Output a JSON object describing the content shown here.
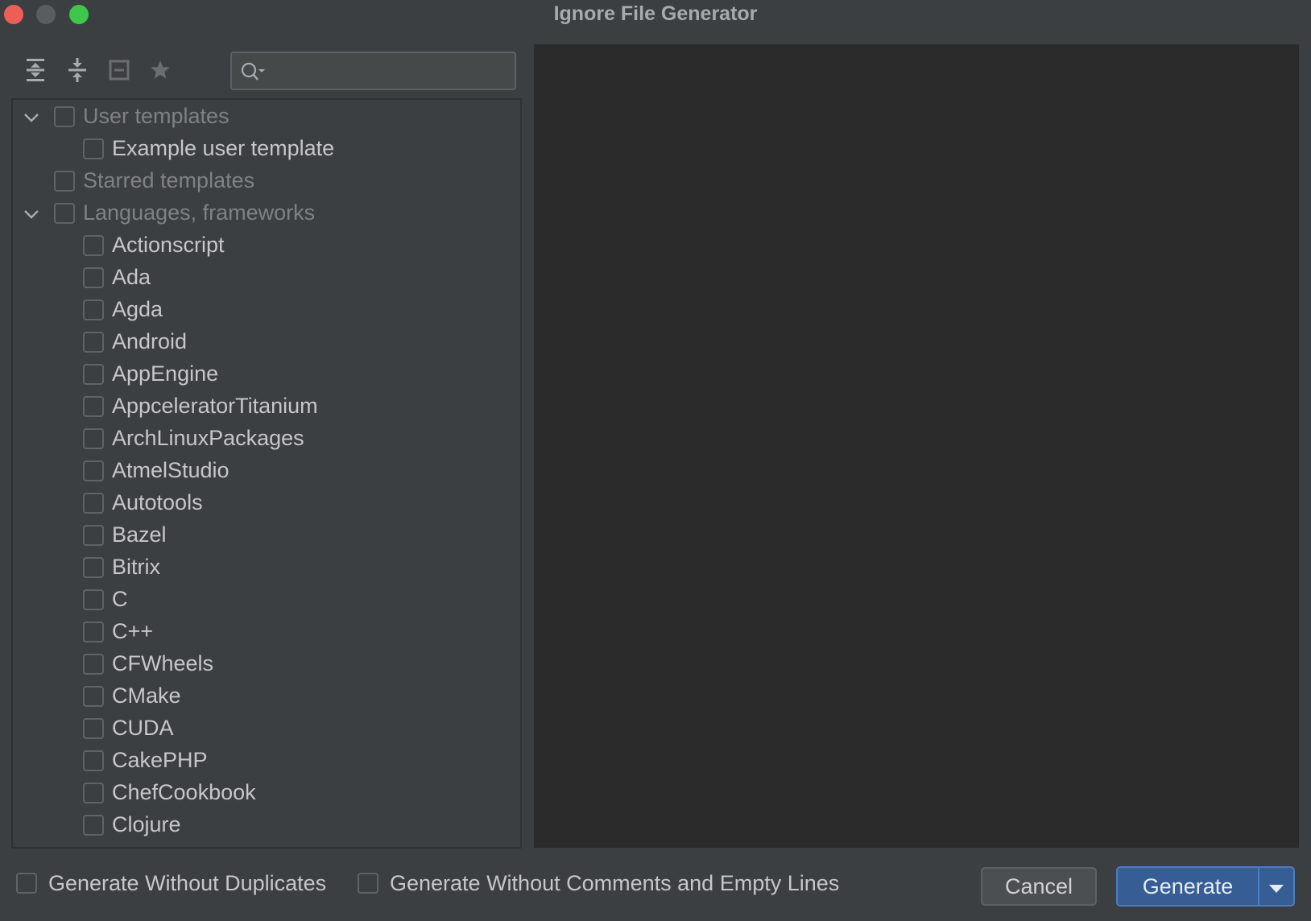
{
  "window": {
    "title": "Ignore File Generator"
  },
  "toolbar": {
    "icons": [
      "expand-all-icon",
      "collapse-all-icon",
      "unselect-all-icon",
      "star-icon"
    ]
  },
  "search": {
    "value": "",
    "placeholder": ""
  },
  "tree": {
    "groups": [
      {
        "label": "User templates",
        "expanded": true,
        "items": [
          "Example user template"
        ]
      },
      {
        "label": "Starred templates",
        "expanded": false,
        "items": []
      },
      {
        "label": "Languages, frameworks",
        "expanded": true,
        "items": [
          "Actionscript",
          "Ada",
          "Agda",
          "Android",
          "AppEngine",
          "AppceleratorTitanium",
          "ArchLinuxPackages",
          "AtmelStudio",
          "Autotools",
          "Bazel",
          "Bitrix",
          "C",
          "C++",
          "CFWheels",
          "CMake",
          "CUDA",
          "CakePHP",
          "ChefCookbook",
          "Clojure"
        ]
      }
    ]
  },
  "options": {
    "without_duplicates": "Generate Without Duplicates",
    "without_comments": "Generate Without Comments and Empty Lines"
  },
  "buttons": {
    "cancel": "Cancel",
    "generate": "Generate"
  },
  "colors": {
    "background": "#3c3f41",
    "preview": "#2b2b2b",
    "primary": "#375e94"
  }
}
